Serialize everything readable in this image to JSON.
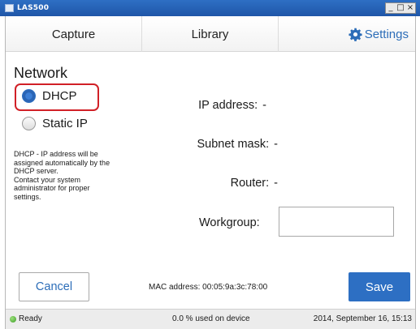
{
  "window": {
    "title": "LAS500",
    "controls": [
      "_",
      "□",
      "×"
    ]
  },
  "tabs": {
    "capture": "Capture",
    "library": "Library",
    "settings": "Settings",
    "active": "settings",
    "settings_icon": "gear-icon"
  },
  "network": {
    "title": "Network",
    "mode_options": [
      {
        "label": "DHCP",
        "selected": true
      },
      {
        "label": "Static IP",
        "selected": false
      }
    ],
    "help_text": "DHCP - IP address will be\nassigned automatically by the\nDHCP server.\nContact your system\nadministrator for proper\nsettings.",
    "ip_address": {
      "label": "IP address:",
      "value": "-"
    },
    "subnet_mask": {
      "label": "Subnet mask:",
      "value": "-"
    },
    "router": {
      "label": "Router:",
      "value": "-"
    },
    "workgroup": {
      "label": "Workgroup:",
      "value": ""
    }
  },
  "footer": {
    "cancel_label": "Cancel",
    "mac_address": "MAC address: 00:05:9a:3c:78:00",
    "save_label": "Save"
  },
  "status": {
    "ready": "Ready",
    "usage": "0.0 % used on device",
    "datetime": "2014, September 16, 15:13"
  },
  "colors": {
    "accent": "#2d6fc3",
    "highlight": "#d12027",
    "ready": "#3f9e2a"
  }
}
